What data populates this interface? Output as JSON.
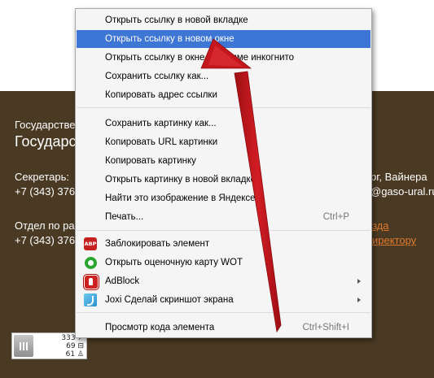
{
  "background": {
    "line1": "Государстве",
    "line2": "Государс",
    "secretary_left": "Секретарь:",
    "secretary_right": "рг, Вайнера",
    "phone1_left": "+7 (343) 376",
    "phone1_right": "@gaso-ural.ru",
    "dept_left": "Отдел по ра",
    "dept_right": "зда",
    "phone2_left": "+7 (343) 376",
    "phone2_right": "иректору",
    "counter": {
      "views": "333 ↗",
      "visits": "69 ⊟",
      "visitors": "61 ♙"
    }
  },
  "colors": {
    "brown_bg": "#4a3a24",
    "highlight": "#3e76d6",
    "arrow": "#c4161c",
    "link": "#e07a2a"
  },
  "context_menu": {
    "items": [
      {
        "label": "Открыть ссылку в новой вкладке"
      },
      {
        "label": "Открыть ссылку в новом окне",
        "highlighted": true
      },
      {
        "label": "Открыть ссылку в окне в режиме инкогнито"
      },
      {
        "label": "Сохранить ссылку как..."
      },
      {
        "label": "Копировать адрес ссылки"
      },
      {
        "label": "Сохранить картинку как..."
      },
      {
        "label": "Копировать URL картинки"
      },
      {
        "label": "Копировать картинку"
      },
      {
        "label": "Открыть картинку в новой вкладке"
      },
      {
        "label": "Найти это изображение в Яндексе"
      },
      {
        "label": "Печать...",
        "shortcut": "Ctrl+P"
      },
      {
        "label": "Заблокировать элемент",
        "icon": "adblock-plus-icon"
      },
      {
        "label": "Открыть оценочную карту WOT",
        "icon": "wot-icon"
      },
      {
        "label": "AdBlock",
        "icon": "adblock-icon",
        "submenu": true
      },
      {
        "label": "Joxi Сделай скриншот экрана",
        "icon": "joxi-icon",
        "submenu": true
      },
      {
        "label": "Просмотр кода элемента",
        "shortcut": "Ctrl+Shift+I"
      }
    ],
    "abp_icon_text": "ABP"
  }
}
